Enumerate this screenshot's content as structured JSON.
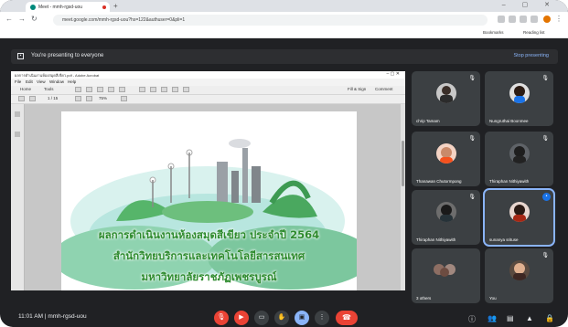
{
  "browser": {
    "tab_title": "Meet - mmh-rgsd-uou",
    "new_tab_symbol": "+",
    "url": "meet.google.com/mmh-rgsd-uou?hs=122&authuser=0&pli=1",
    "bookmarks": [
      "Bookmarks",
      "Reading list"
    ]
  },
  "banner": {
    "text": "You're presenting to everyone",
    "stop_label": "Stop presenting"
  },
  "shared_app": {
    "title": "ผลการดำเนินงานห้องสมุดสีเขียว.pdf - Adobe Acrobat",
    "menu": [
      "File",
      "Edit",
      "View",
      "Window",
      "Help"
    ],
    "tool_labels": [
      "Home",
      "Tools"
    ],
    "page_value": "1 / 15",
    "zoom_value": "75%",
    "right_tools": [
      "Fill & Sign",
      "Comment"
    ]
  },
  "slide": {
    "line1": "ผลการดำเนินงานห้องสมุดสีเขียว ประจำปี 2564",
    "line2": "สำนักวิทยบริการและเทคโนโลยีสารสนเทศ",
    "line3": "มหาวิทยาลัยราชภัฏเพชรบูรณ์"
  },
  "participants": [
    {
      "name": "chrip Tamam"
    },
    {
      "name": "Nungruthai Boonmee"
    },
    {
      "name": "Thanawan Chutormpong"
    },
    {
      "name": "Thiraphan Nithiyawith"
    },
    {
      "name": "Thiraphan Nithiyawith"
    },
    {
      "name": "sunanya srituse"
    },
    {
      "name": "3 others"
    },
    {
      "name": "You"
    }
  ],
  "bottom": {
    "time": "11:01 AM",
    "separator": "|",
    "meeting_code": "mmh-rgsd-uou"
  },
  "colors": {
    "meet_bg": "#202124",
    "tile_bg": "#3c4043",
    "end_call": "#ea4335",
    "accent": "#8ab4f8",
    "slide_text": "#2e8b2e"
  }
}
